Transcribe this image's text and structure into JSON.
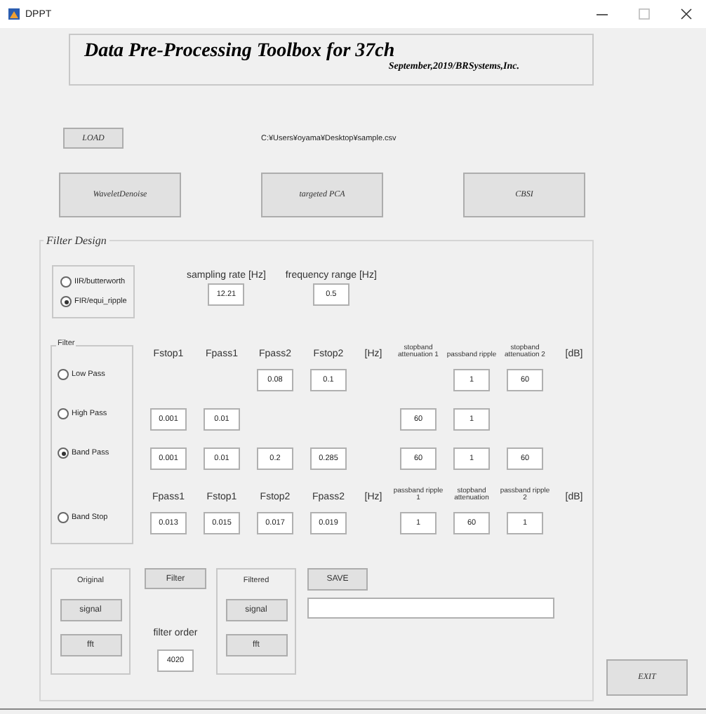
{
  "window": {
    "title": "DPPT"
  },
  "header": {
    "title": "Data Pre-Processing Toolbox for 37ch",
    "subtitle": "September,2019/BRSystems,Inc."
  },
  "load_button": "LOAD",
  "file_path": "C:¥Users¥oyama¥Desktop¥sample.csv",
  "tools": [
    "WaveletDenoise",
    "targeted PCA",
    "CBSI"
  ],
  "filter_design": {
    "label": "Filter Design",
    "types": [
      {
        "label": "IIR/butterworth",
        "selected": false
      },
      {
        "label": "FIR/equi_ripple",
        "selected": true
      }
    ],
    "sampling_rate": {
      "label": "sampling rate",
      "unit": "[Hz]",
      "value": "12.21"
    },
    "frequency_range": {
      "label": "frequency range",
      "unit": "[Hz]",
      "value": "0.5"
    },
    "filter_label": "Filter",
    "headers": {
      "frequency": [
        "Fstop1",
        "Fpass1",
        "Fpass2",
        "Fstop2"
      ],
      "frequency_unit": "[Hz]",
      "db": [
        "stopband attenuation 1",
        "passband ripple",
        "stopband attenuation 2"
      ],
      "db_unit": "[dB]"
    },
    "filters": [
      {
        "label": "Low Pass",
        "selected": false,
        "frequencies": {
          "column_3": "0.08",
          "column_4": "0.1"
        },
        "db": {
          "column_2": "1",
          "column_3": "60"
        }
      },
      {
        "label": "High Pass",
        "selected": false,
        "frequencies": {
          "column_1": "0.001",
          "column_2": "0.01"
        },
        "db": {
          "column_1": "60",
          "column_2": "1"
        }
      },
      {
        "label": "Band Pass",
        "selected": true,
        "frequencies": {
          "column_1": "0.001",
          "column_2": "0.01",
          "column_3": "0.2",
          "column_4": "0.285"
        },
        "db": {
          "column_1": "60",
          "column_2": "1",
          "column_3": "60"
        }
      },
      {
        "label": "Band Stop",
        "selected": false,
        "headers": {
          "frequency": [
            "Fpass1",
            "Fstop1",
            "Fstop2",
            "Fpass2"
          ],
          "frequency_unit": "[Hz]",
          "db": [
            "passband ripple 1",
            "stopband attenuation",
            "passband ripple 2"
          ],
          "db_unit": "[dB]"
        },
        "frequencies": {
          "column_1": "0.013",
          "column_2": "0.015",
          "column_3": "0.017",
          "column_4": "0.019"
        },
        "db": {
          "column_1": "1",
          "column_2": "60",
          "column_3": "1"
        }
      }
    ]
  },
  "original": {
    "label": "Original",
    "buttons": [
      "signal",
      "fft"
    ]
  },
  "filter_button": "Filter",
  "filter_order": {
    "label": "filter order",
    "value": "4020"
  },
  "filtered": {
    "label": "Filtered",
    "buttons": [
      "signal",
      "fft"
    ]
  },
  "save_button": "SAVE",
  "exit_button": "EXIT"
}
